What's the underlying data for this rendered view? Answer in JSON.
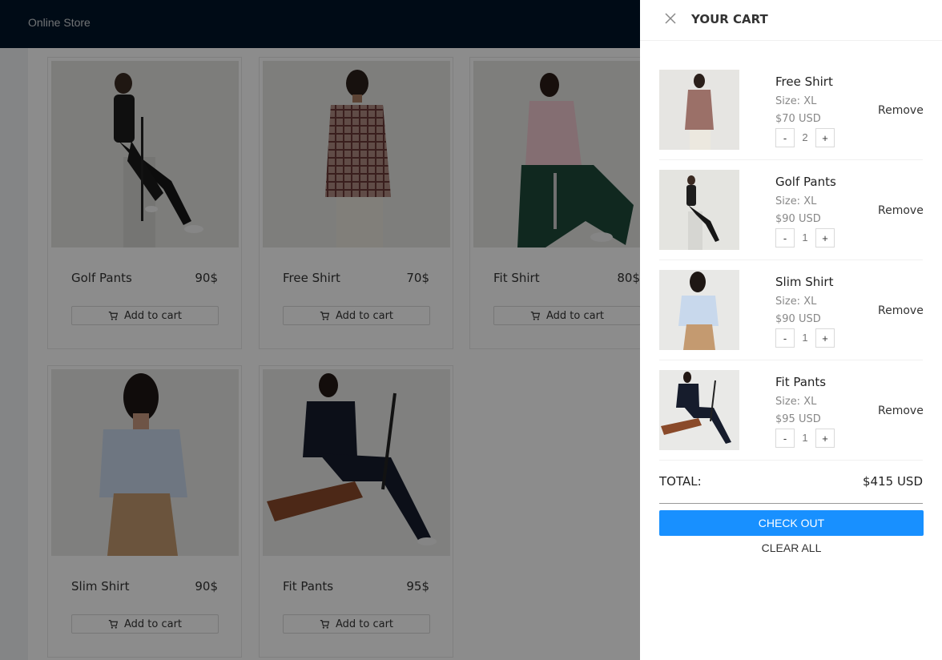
{
  "header": {
    "brand": "Online Store"
  },
  "products": [
    {
      "name": "Golf Pants",
      "price": "90$",
      "add_label": "Add to cart",
      "image": "golf-pants-photo"
    },
    {
      "name": "Free Shirt",
      "price": "70$",
      "add_label": "Add to cart",
      "image": "free-shirt-photo"
    },
    {
      "name": "Fit Shirt",
      "price": "80$",
      "add_label": "Add to cart",
      "image": "fit-shirt-photo"
    },
    {
      "name": "Slim Shirt",
      "price": "90$",
      "add_label": "Add to cart",
      "image": "slim-shirt-photo"
    },
    {
      "name": "Fit Pants",
      "price": "95$",
      "add_label": "Add to cart",
      "image": "fit-pants-photo"
    }
  ],
  "cart": {
    "title": "YOUR CART",
    "close_icon": "close-icon",
    "items": [
      {
        "name": "Free Shirt",
        "size": "Size: XL",
        "price": "$70 USD",
        "qty": "2",
        "minus": "-",
        "plus": "+",
        "remove": "Remove"
      },
      {
        "name": "Golf Pants",
        "size": "Size: XL",
        "price": "$90 USD",
        "qty": "1",
        "minus": "-",
        "plus": "+",
        "remove": "Remove"
      },
      {
        "name": "Slim Shirt",
        "size": "Size: XL",
        "price": "$90 USD",
        "qty": "1",
        "minus": "-",
        "plus": "+",
        "remove": "Remove"
      },
      {
        "name": "Fit Pants",
        "size": "Size: XL",
        "price": "$95 USD",
        "qty": "1",
        "minus": "-",
        "plus": "+",
        "remove": "Remove"
      }
    ],
    "total_label": "TOTAL:",
    "total_value": "$415 USD",
    "checkout_label": "CHECK OUT",
    "clear_label": "CLEAR ALL"
  },
  "colors": {
    "header": "#001529",
    "primary": "#1890ff"
  }
}
